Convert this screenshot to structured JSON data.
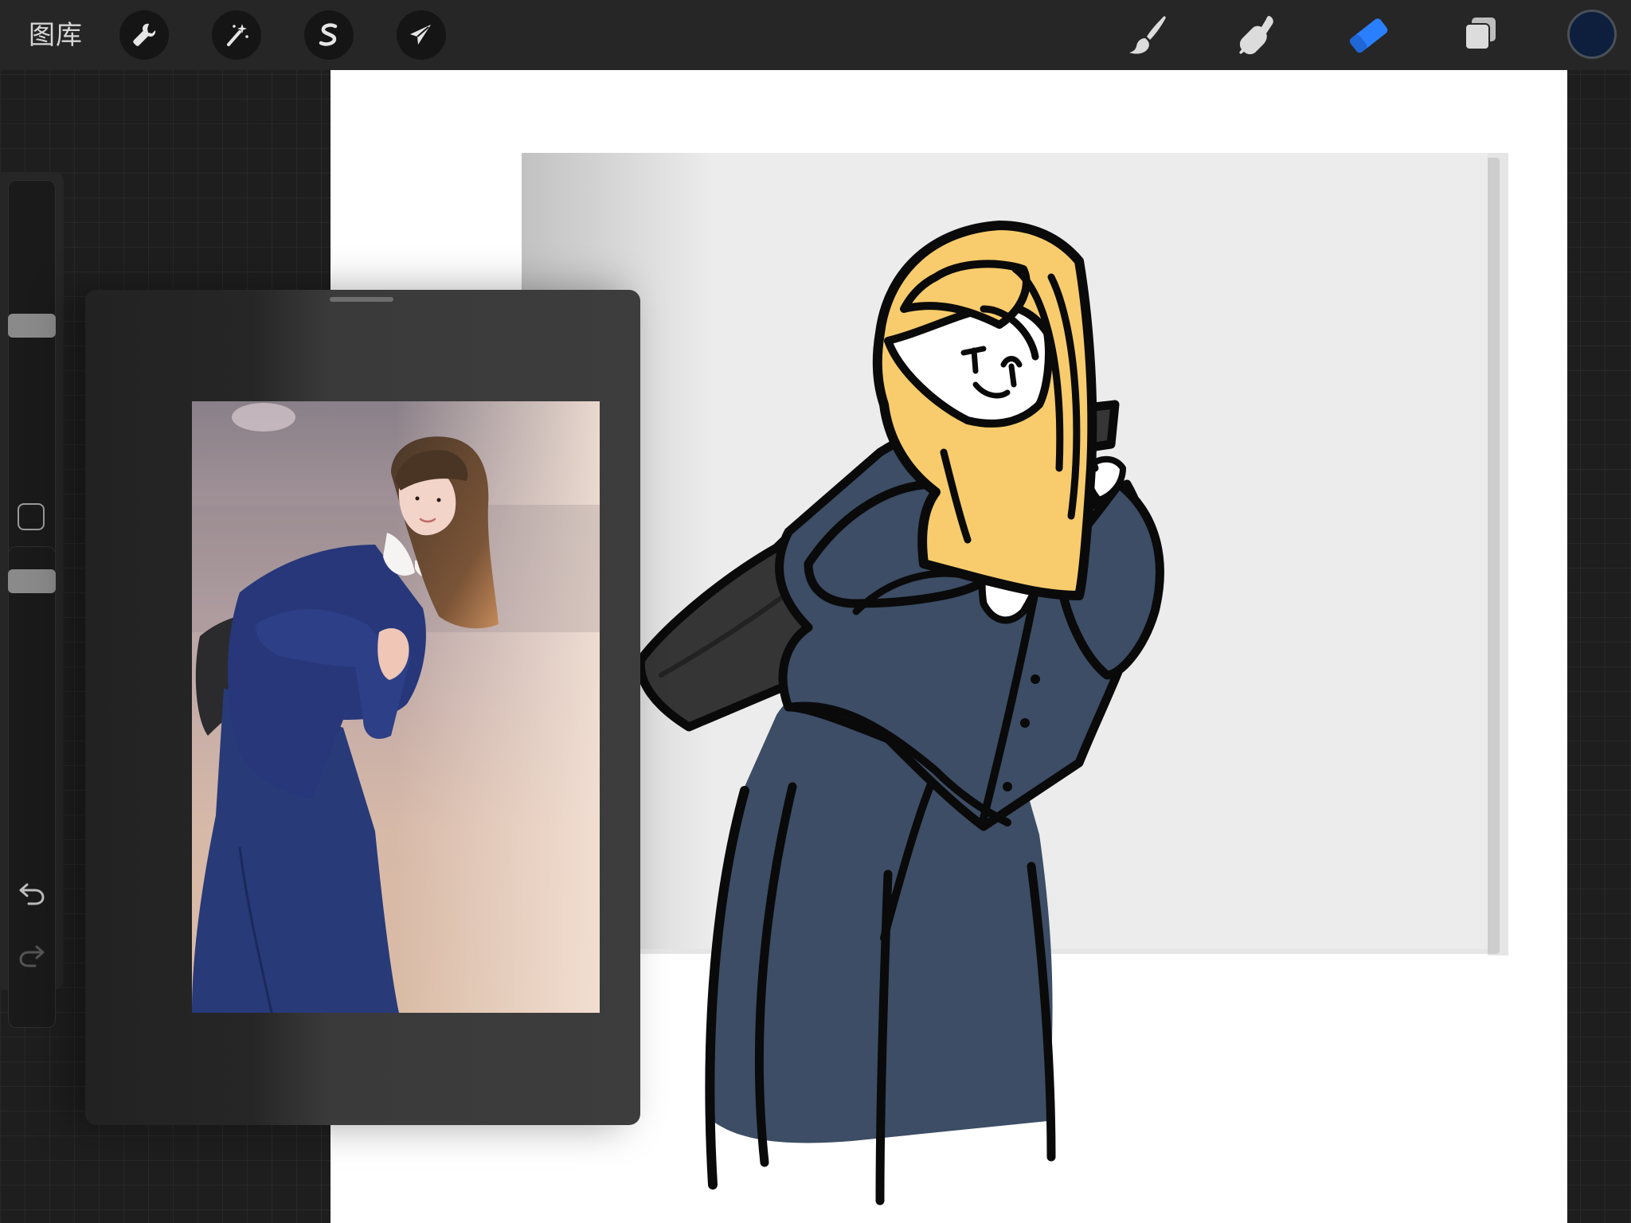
{
  "toolbar": {
    "gallery_label": "图库",
    "left_tools": [
      {
        "name": "actions",
        "icon": "wrench-icon"
      },
      {
        "name": "adjustments",
        "icon": "magic-wand-icon"
      },
      {
        "name": "selection",
        "icon": "selection-s-icon"
      },
      {
        "name": "transform",
        "icon": "arrow-cursor-icon"
      }
    ],
    "right_tools": [
      {
        "name": "paint",
        "icon": "brush-icon"
      },
      {
        "name": "smudge",
        "icon": "smudge-finger-icon"
      },
      {
        "name": "erase",
        "icon": "eraser-icon"
      },
      {
        "name": "layers",
        "icon": "layers-icon"
      }
    ],
    "active_tool": "erase",
    "current_color": "#0d1f3c",
    "active_color": "#2a7fff"
  },
  "sidebar": {
    "brush_size_level": 0.32,
    "opacity_level": 0.05,
    "modify_button": "square-icon",
    "undo": "undo-arrow-icon",
    "redo": "redo-arrow-icon"
  },
  "reference": {
    "title": "",
    "image": "reference-photo"
  },
  "colors": {
    "hair": "#f8cc6c",
    "coat": "#3c4d65",
    "bag": "#353535",
    "outline": "#0a0a0a",
    "panel_gray": "#ececec"
  }
}
